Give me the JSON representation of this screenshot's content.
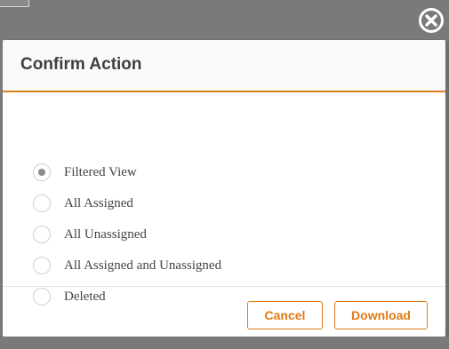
{
  "modal": {
    "title": "Confirm Action",
    "options": [
      {
        "label": "Filtered View",
        "selected": true
      },
      {
        "label": "All Assigned",
        "selected": false
      },
      {
        "label": "All Unassigned",
        "selected": false
      },
      {
        "label": "All Assigned and Unassigned",
        "selected": false
      },
      {
        "label": "Deleted",
        "selected": false
      }
    ],
    "buttons": {
      "cancel": "Cancel",
      "download": "Download"
    }
  },
  "icons": {
    "close": "close-circle-icon",
    "radio": "radio-button-icon"
  },
  "colors": {
    "accent": "#e07b16",
    "overlay": "#7a7a7a",
    "text": "#444444"
  }
}
